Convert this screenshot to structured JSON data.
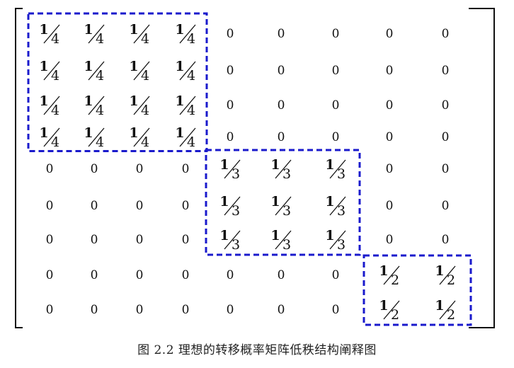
{
  "figure": {
    "matrix": [
      [
        "1/4",
        "1/4",
        "1/4",
        "1/4",
        "0",
        "0",
        "0",
        "0",
        "0"
      ],
      [
        "1/4",
        "1/4",
        "1/4",
        "1/4",
        "0",
        "0",
        "0",
        "0",
        "0"
      ],
      [
        "1/4",
        "1/4",
        "1/4",
        "1/4",
        "0",
        "0",
        "0",
        "0",
        "0"
      ],
      [
        "1/4",
        "1/4",
        "1/4",
        "1/4",
        "0",
        "0",
        "0",
        "0",
        "0"
      ],
      [
        "0",
        "0",
        "0",
        "0",
        "1/3",
        "1/3",
        "1/3",
        "0",
        "0"
      ],
      [
        "0",
        "0",
        "0",
        "0",
        "1/3",
        "1/3",
        "1/3",
        "0",
        "0"
      ],
      [
        "0",
        "0",
        "0",
        "0",
        "1/3",
        "1/3",
        "1/3",
        "0",
        "0"
      ],
      [
        "0",
        "0",
        "0",
        "0",
        "0",
        "0",
        "0",
        "1/2",
        "1/2"
      ],
      [
        "0",
        "0",
        "0",
        "0",
        "0",
        "0",
        "0",
        "1/2",
        "1/2"
      ]
    ],
    "blocks": [
      {
        "rows": [
          0,
          3
        ],
        "cols": [
          0,
          3
        ]
      },
      {
        "rows": [
          4,
          6
        ],
        "cols": [
          4,
          6
        ]
      },
      {
        "rows": [
          7,
          8
        ],
        "cols": [
          7,
          8
        ]
      }
    ],
    "block_color": "#1a1acc",
    "caption": "图 2.2   理想的转移概率矩阵低秩结构阐释图"
  }
}
